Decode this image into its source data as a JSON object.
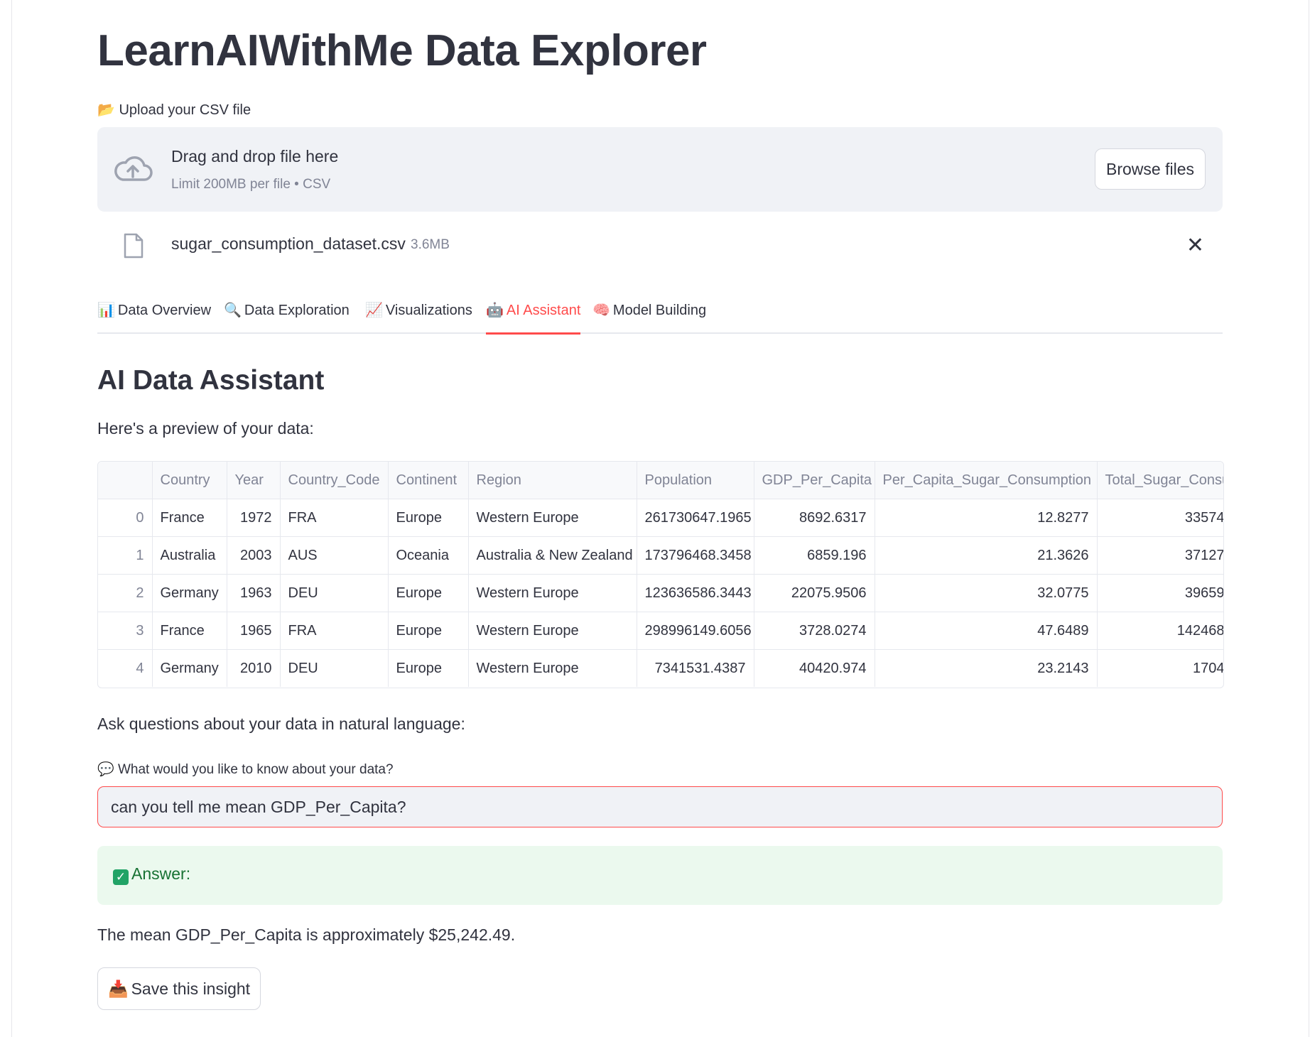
{
  "app": {
    "title": "LearnAIWithMe Data Explorer"
  },
  "upload": {
    "label_icon": "📂",
    "label": "Upload your CSV file",
    "drop_title": "Drag and drop file here",
    "drop_limit": "Limit 200MB per file • CSV",
    "browse_label": "Browse files",
    "file_name": "sugar_consumption_dataset.csv",
    "file_size": "3.6MB",
    "close_glyph": "✕"
  },
  "tabs": [
    {
      "icon": "📊",
      "label": "Data Overview",
      "active": false
    },
    {
      "icon": "🔍",
      "label": "Data Exploration",
      "active": false
    },
    {
      "icon": "📈",
      "label": "Visualizations",
      "active": false
    },
    {
      "icon": "🤖",
      "label": "AI Assistant",
      "active": true
    },
    {
      "icon": "🧠",
      "label": "Model Building",
      "active": false
    }
  ],
  "assistant": {
    "title": "AI Data Assistant",
    "preview_text": "Here's a preview of your data:",
    "ask_text": "Ask questions about your data in natural language:",
    "question_icon": "💬",
    "question_label": "What would you like to know about your data?",
    "question_value": "can you tell me mean GDP_Per_Capita?",
    "answer_check": "✓",
    "answer_label": "Answer:",
    "answer_text": "The mean GDP_Per_Capita is approximately $25,242.49.",
    "save_icon": "📥",
    "save_label": "Save this insight"
  },
  "table": {
    "columns": [
      "",
      "Country",
      "Year",
      "Country_Code",
      "Continent",
      "Region",
      "Population",
      "GDP_Per_Capita",
      "Per_Capita_Sugar_Consumption",
      "Total_Sugar_Consu"
    ],
    "rows": [
      [
        "0",
        "France",
        "1972",
        "FRA",
        "Europe",
        "Western Europe",
        "261730647.1965",
        "8692.6317",
        "12.8277",
        "33574"
      ],
      [
        "1",
        "Australia",
        "2003",
        "AUS",
        "Oceania",
        "Australia & New Zealand",
        "173796468.3458",
        "6859.196",
        "21.3626",
        "37127"
      ],
      [
        "2",
        "Germany",
        "1963",
        "DEU",
        "Europe",
        "Western Europe",
        "123636586.3443",
        "22075.9506",
        "32.0775",
        "39659"
      ],
      [
        "3",
        "France",
        "1965",
        "FRA",
        "Europe",
        "Western Europe",
        "298996149.6056",
        "3728.0274",
        "47.6489",
        "142468"
      ],
      [
        "4",
        "Germany",
        "2010",
        "DEU",
        "Europe",
        "Western Europe",
        "7341531.4387",
        "40420.974",
        "23.2143",
        "1704"
      ]
    ]
  },
  "colors": {
    "accent": "#ff4b4b",
    "success_bg": "#ebf9ee",
    "success_text": "#177233",
    "panel_bg": "#f0f2f6"
  }
}
